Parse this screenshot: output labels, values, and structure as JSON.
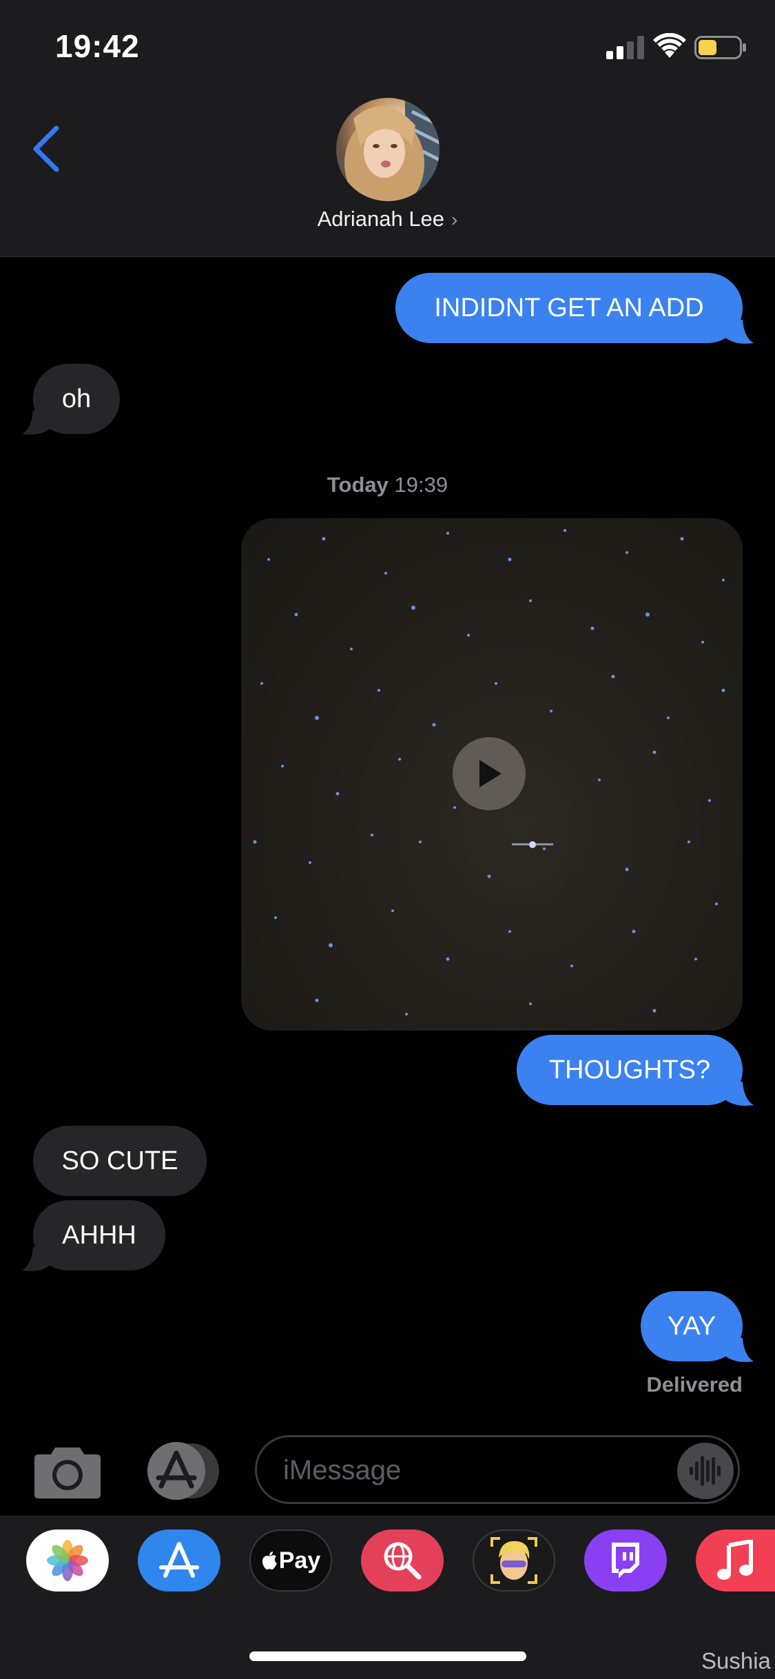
{
  "status_bar": {
    "time": "19:42"
  },
  "header": {
    "contact_name": "Adrianah Lee",
    "contact_chevron": "›"
  },
  "messages": {
    "m1": {
      "text": "INDIDNT GET AN ADD",
      "direction": "outgoing"
    },
    "m2": {
      "text": "oh",
      "direction": "incoming"
    },
    "timestamp_day": "Today",
    "timestamp_time": "19:39",
    "m3": {
      "type": "video",
      "direction": "outgoing"
    },
    "m4": {
      "text": "THOUGHTS?",
      "direction": "outgoing"
    },
    "m5": {
      "text": "SO CUTE",
      "direction": "incoming"
    },
    "m6": {
      "text": "AHHH",
      "direction": "incoming"
    },
    "m7": {
      "text": "YAY",
      "direction": "outgoing"
    },
    "delivered": "Delivered"
  },
  "composer": {
    "placeholder": "iMessage"
  },
  "app_drawer": {
    "apps": [
      "photos-app",
      "app-store-app",
      "apple-pay-app",
      "search-images-app",
      "memoji-app",
      "twitch-app",
      "music-app"
    ],
    "apple_pay_label": "Pay"
  },
  "watermark": "Sushia",
  "colors": {
    "outgoing_bubble": "#3b82f0",
    "incoming_bubble": "#262628",
    "header_bg": "#1c1c1e",
    "accent_blue": "#3478f6",
    "battery_fill": "#f6d34a"
  }
}
